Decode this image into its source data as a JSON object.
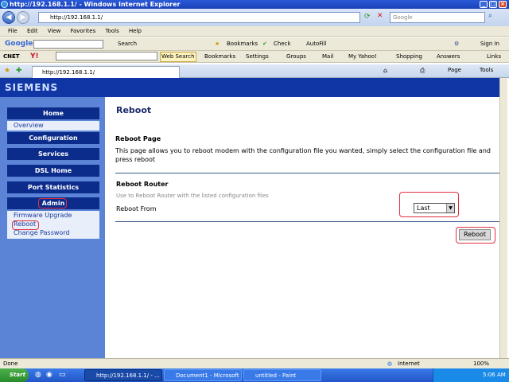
{
  "window": {
    "title": "http://192.168.1.1/ - Windows Internet Explorer"
  },
  "address": {
    "url": "http://192.168.1.1/",
    "search_placeholder": "Google"
  },
  "menu": [
    "File",
    "Edit",
    "View",
    "Favorites",
    "Tools",
    "Help"
  ],
  "google_toolbar": {
    "brand": "Google",
    "search": "Search",
    "bookmarks": "Bookmarks",
    "check": "Check",
    "autofill": "AutoFill",
    "signin": "Sign In"
  },
  "cnet_toolbar": {
    "cnet": "CNET",
    "yahoo": "Y!",
    "web_search": "Web Search",
    "bookmarks": "Bookmarks",
    "settings": "Settings",
    "groups": "Groups",
    "mail": "Mail",
    "my_yahoo": "My Yahoo!",
    "shopping": "Shopping",
    "answers": "Answers",
    "links": "Links"
  },
  "tab": {
    "label": "http://192.168.1.1/"
  },
  "tab_tools": {
    "page": "Page",
    "tools": "Tools"
  },
  "brand": "SIEMENS",
  "sidebar": {
    "home": "Home",
    "home_sub": [
      "Overview"
    ],
    "configuration": "Configuration",
    "services": "Services",
    "dsl_home": "DSL Home",
    "port_statistics": "Port Statistics",
    "admin": "Admin",
    "admin_sub": [
      "Firmware Upgrade",
      "Reboot",
      "Change Password"
    ]
  },
  "main": {
    "title": "Reboot",
    "section_heading": "Reboot Page",
    "section_desc": "This page allows you to reboot modem with the configuration file you wanted, simply select the configuration file and press reboot",
    "router_heading": "Reboot Router",
    "router_hint": "Use to Reboot Router with the listed configuration files",
    "reboot_from_label": "Reboot From",
    "reboot_from_value": "Last",
    "reboot_button": "Reboot"
  },
  "status": {
    "text": "Done",
    "zone": "Internet",
    "zoom": "100%"
  },
  "taskbar": {
    "start": "Start",
    "task1": "http://192.168.1.1/ - ...",
    "task2": "Document1 - Microsoft ...",
    "task3": "untitled - Paint",
    "clock": "5:06 AM"
  },
  "colors": {
    "brand_bar": "#1036a6",
    "sidebar": "#5b84d6",
    "nav_button": "#0c2c8c",
    "highlight": "#e03040"
  }
}
